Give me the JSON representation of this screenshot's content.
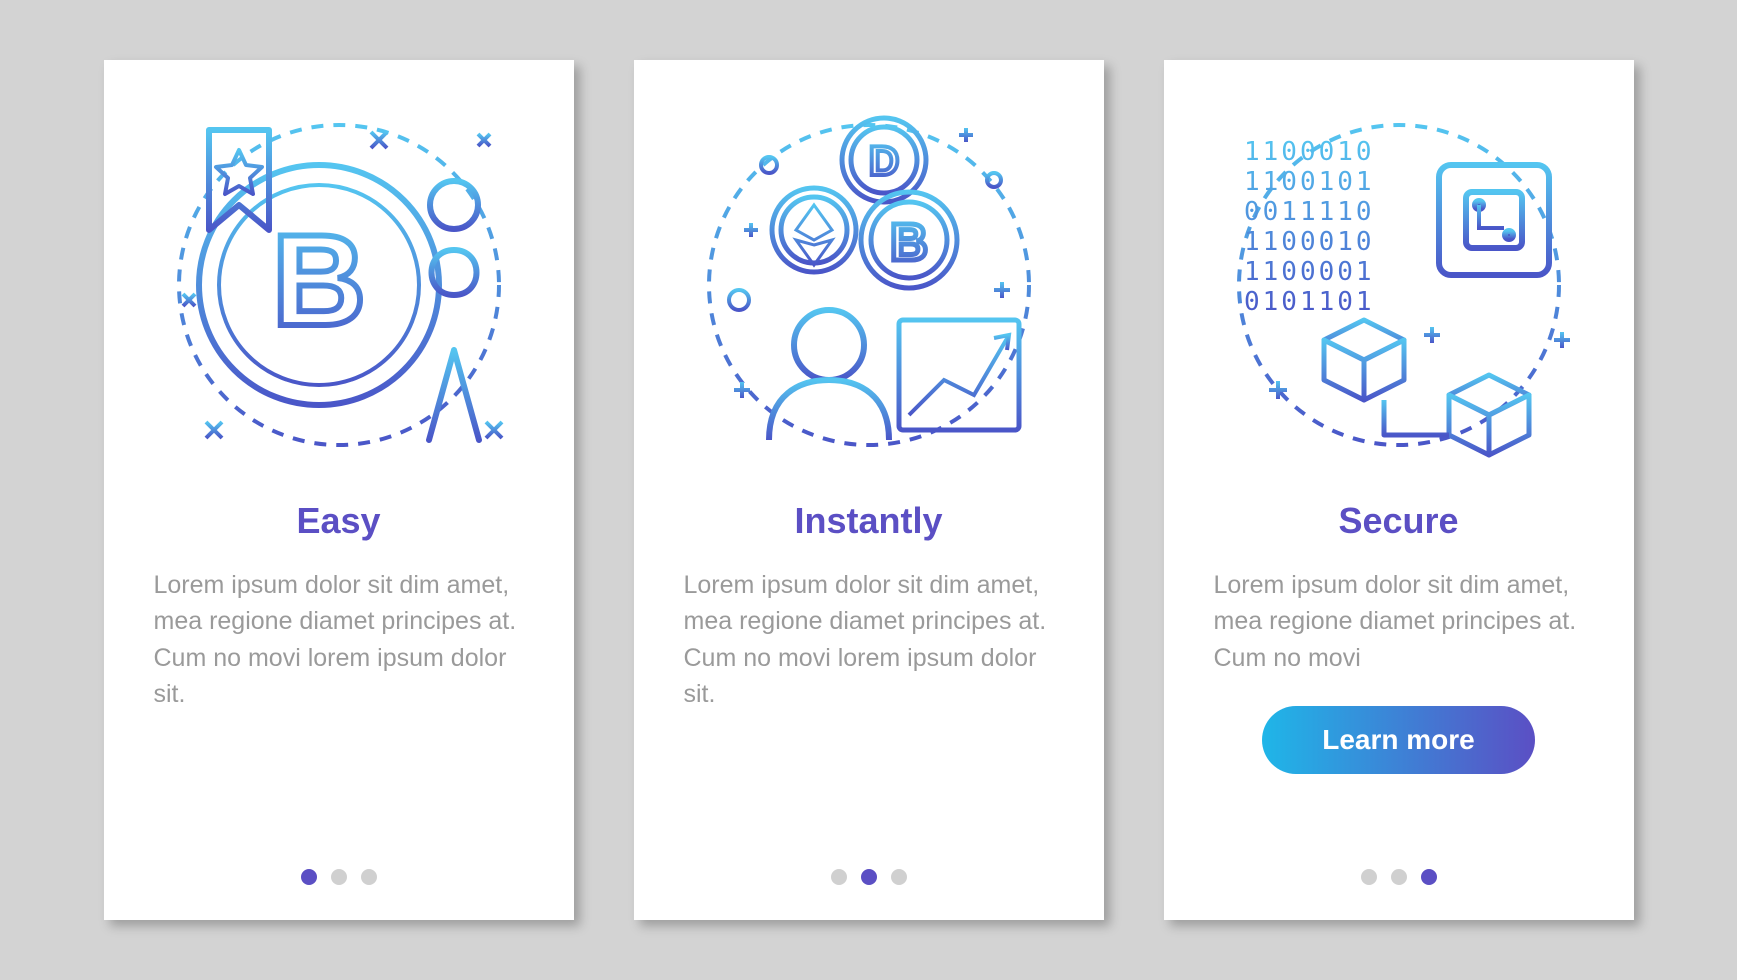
{
  "cards": [
    {
      "title": "Easy",
      "desc": "Lorem ipsum dolor sit dim amet, mea regione diamet principes at. Cum no movi lorem ipsum dolor sit.",
      "activeDot": 0,
      "button": null
    },
    {
      "title": "Instantly",
      "desc": "Lorem ipsum dolor sit dim amet, mea regione diamet principes at. Cum no movi lorem ipsum dolor sit.",
      "activeDot": 1,
      "button": null
    },
    {
      "title": "Secure",
      "desc": "Lorem ipsum dolor sit dim amet, mea regione diamet principes at. Cum no movi",
      "activeDot": 2,
      "button": "Learn more"
    }
  ],
  "colors": {
    "grad_start": "#1fb6e8",
    "grad_end": "#5b4fc4",
    "stroke_light": "#54c5f0",
    "stroke_dark": "#4a56c8"
  }
}
